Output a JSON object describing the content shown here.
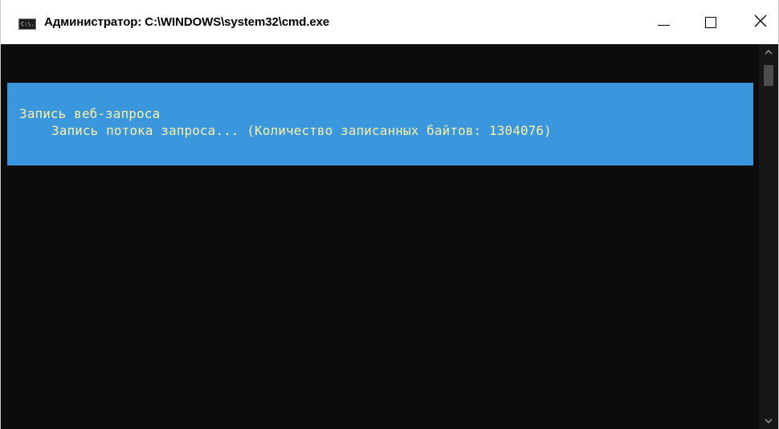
{
  "window": {
    "icon_text": "C:\\.",
    "title": "Администратор: C:\\WINDOWS\\system32\\cmd.exe"
  },
  "console": {
    "progress_title": "Запись веб-запроса",
    "progress_status": "Запись потока запроса... (Количество записанных байтов: 1304076)"
  },
  "colors": {
    "console_background": "#0c0c0c",
    "progress_background": "#3a96dd",
    "progress_text": "#f9f1a5"
  },
  "icons": {
    "minimize": "minimize-icon",
    "maximize": "maximize-icon",
    "close": "close-icon",
    "scroll_up": "chevron-up-icon",
    "scroll_down": "chevron-down-icon"
  }
}
